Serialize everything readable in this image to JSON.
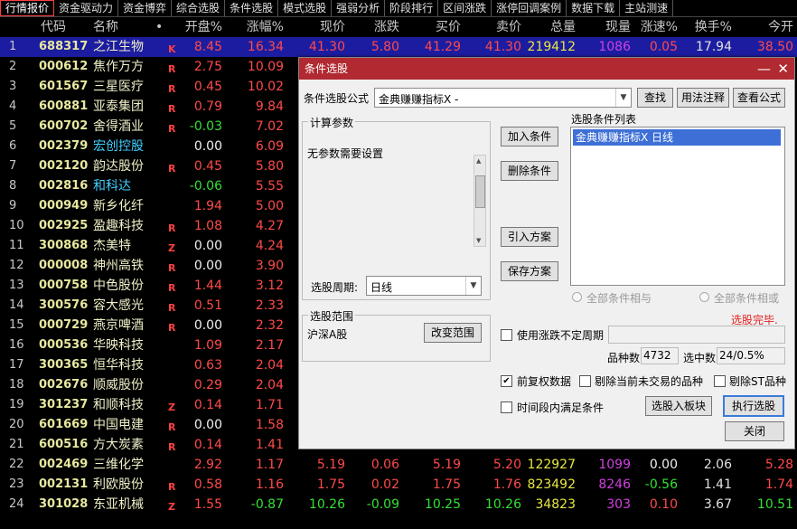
{
  "tabs": [
    "行情报价",
    "资金驱动力",
    "资金博弈",
    "综合选股",
    "条件选股",
    "模式选股",
    "强弱分析",
    "阶段排行",
    "区间涨跌",
    "涨停回调案例",
    "数据下载",
    "主站测速"
  ],
  "columns": {
    "code": "代码",
    "name": "名称",
    "dot": "•",
    "open": "开盘%",
    "chg": "涨幅%",
    "price": "现价",
    "diff": "涨跌",
    "buy": "买价",
    "sell": "卖价",
    "vol": "总量",
    "cur": "现量",
    "spd": "涨速%",
    "turn": "换手%",
    "today": "今开"
  },
  "rows": [
    {
      "idx": "1",
      "code": "688317",
      "name": "之江生物",
      "mark": "K",
      "open": "8.45",
      "chg": "16.34",
      "price": "41.30",
      "diff": "5.80",
      "buy": "41.29",
      "sell": "41.30",
      "vol": "219412",
      "cur": "1086",
      "spd": "0.05",
      "turn": "17.94",
      "today": "38.50",
      "oc": "red",
      "cc": "red",
      "nc": ""
    },
    {
      "idx": "2",
      "code": "000612",
      "name": "焦作万方",
      "mark": "R",
      "open": "2.75",
      "chg": "10.09",
      "oc": "red",
      "cc": "red",
      "nc": ""
    },
    {
      "idx": "3",
      "code": "601567",
      "name": "三星医疗",
      "mark": "R",
      "open": "0.45",
      "chg": "10.02",
      "oc": "red",
      "cc": "red",
      "nc": ""
    },
    {
      "idx": "4",
      "code": "600881",
      "name": "亚泰集团",
      "mark": "R",
      "open": "0.79",
      "chg": "9.84",
      "oc": "red",
      "cc": "red",
      "nc": ""
    },
    {
      "idx": "5",
      "code": "600702",
      "name": "舍得酒业",
      "mark": "R",
      "open": "-0.03",
      "chg": "7.02",
      "oc": "green",
      "cc": "red",
      "nc": ""
    },
    {
      "idx": "6",
      "code": "002379",
      "name": "宏创控股",
      "mark": "",
      "open": "0.00",
      "chg": "6.09",
      "oc": "white",
      "cc": "red",
      "nc": "cyan"
    },
    {
      "idx": "7",
      "code": "002120",
      "name": "韵达股份",
      "mark": "R",
      "open": "0.45",
      "chg": "5.80",
      "oc": "red",
      "cc": "red",
      "nc": ""
    },
    {
      "idx": "8",
      "code": "002816",
      "name": "和科达",
      "mark": "",
      "open": "-0.06",
      "chg": "5.55",
      "oc": "green",
      "cc": "red",
      "nc": "cyan"
    },
    {
      "idx": "9",
      "code": "000949",
      "name": "新乡化纤",
      "mark": "",
      "open": "1.94",
      "chg": "5.00",
      "oc": "red",
      "cc": "red",
      "nc": ""
    },
    {
      "idx": "10",
      "code": "002925",
      "name": "盈趣科技",
      "mark": "R",
      "open": "1.08",
      "chg": "4.27",
      "oc": "red",
      "cc": "red",
      "nc": ""
    },
    {
      "idx": "11",
      "code": "300868",
      "name": "杰美特",
      "mark": "Z",
      "open": "0.00",
      "chg": "4.24",
      "oc": "white",
      "cc": "red",
      "nc": ""
    },
    {
      "idx": "12",
      "code": "000008",
      "name": "神州高铁",
      "mark": "R",
      "open": "0.00",
      "chg": "3.90",
      "oc": "white",
      "cc": "red",
      "nc": ""
    },
    {
      "idx": "13",
      "code": "000758",
      "name": "中色股份",
      "mark": "R",
      "open": "1.44",
      "chg": "3.12",
      "oc": "red",
      "cc": "red",
      "nc": ""
    },
    {
      "idx": "14",
      "code": "300576",
      "name": "容大感光",
      "mark": "R",
      "open": "0.51",
      "chg": "2.33",
      "oc": "red",
      "cc": "red",
      "nc": ""
    },
    {
      "idx": "15",
      "code": "000729",
      "name": "燕京啤酒",
      "mark": "R",
      "open": "0.00",
      "chg": "2.32",
      "oc": "white",
      "cc": "red",
      "nc": ""
    },
    {
      "idx": "16",
      "code": "000536",
      "name": "华映科技",
      "mark": "",
      "open": "1.09",
      "chg": "2.17",
      "oc": "red",
      "cc": "red",
      "nc": ""
    },
    {
      "idx": "17",
      "code": "300365",
      "name": "恒华科技",
      "mark": "",
      "open": "0.63",
      "chg": "2.04",
      "oc": "red",
      "cc": "red",
      "nc": ""
    },
    {
      "idx": "18",
      "code": "002676",
      "name": "顺威股份",
      "mark": "",
      "open": "0.29",
      "chg": "2.04",
      "oc": "red",
      "cc": "red",
      "nc": ""
    },
    {
      "idx": "19",
      "code": "301237",
      "name": "和顺科技",
      "mark": "Z",
      "open": "0.14",
      "chg": "1.71",
      "oc": "red",
      "cc": "red",
      "nc": ""
    },
    {
      "idx": "20",
      "code": "601669",
      "name": "中国电建",
      "mark": "R",
      "open": "0.00",
      "chg": "1.58",
      "oc": "white",
      "cc": "red",
      "nc": ""
    },
    {
      "idx": "21",
      "code": "600516",
      "name": "方大炭素",
      "mark": "R",
      "open": "0.14",
      "chg": "1.41",
      "oc": "red",
      "cc": "red",
      "nc": ""
    },
    {
      "idx": "22",
      "code": "002469",
      "name": "三维化学",
      "mark": "",
      "open": "2.92",
      "chg": "1.17",
      "price": "5.19",
      "diff": "0.06",
      "buy": "5.19",
      "sell": "5.20",
      "vol": "122927",
      "cur": "1099",
      "spd": "0.00",
      "turn": "2.06",
      "today": "5.28",
      "oc": "red",
      "cc": "red",
      "nc": ""
    },
    {
      "idx": "23",
      "code": "002131",
      "name": "利欧股份",
      "mark": "R",
      "open": "0.58",
      "chg": "1.16",
      "price": "1.75",
      "diff": "0.02",
      "buy": "1.75",
      "sell": "1.76",
      "vol": "823492",
      "cur": "8246",
      "spd": "-0.56",
      "turn": "1.41",
      "today": "1.74",
      "oc": "red",
      "cc": "red",
      "nc": ""
    },
    {
      "idx": "24",
      "code": "301028",
      "name": "东亚机械",
      "mark": "Z",
      "open": "1.55",
      "chg": "-0.87",
      "price": "10.26",
      "diff": "-0.09",
      "buy": "10.25",
      "sell": "10.26",
      "vol": "34823",
      "cur": "303",
      "spd": "0.10",
      "turn": "3.67",
      "today": "10.51",
      "oc": "red",
      "cc": "green",
      "nc": ""
    }
  ],
  "dialog": {
    "title": "条件选股",
    "formula_label": "条件选股公式",
    "formula_value": "金典赚赚指标X -",
    "btn_find": "查找",
    "btn_usage": "用法注释",
    "btn_view": "查看公式",
    "calc_group": "计算参数",
    "calc_text": "无参数需要设置",
    "period_label": "选股周期:",
    "period_value": "日线",
    "btn_add": "加入条件",
    "btn_del": "删除条件",
    "btn_import": "引入方案",
    "btn_save": "保存方案",
    "list_label": "选股条件列表",
    "list_item": "金典赚赚指标X  日线",
    "radio_and": "全部条件相与",
    "radio_or": "全部条件相或",
    "status": "选股完毕.",
    "range_group": "选股范围",
    "range_value": "沪深A股",
    "btn_range": "改变范围",
    "use_period": "使用涨跌不定周期",
    "count_label": "品种数",
    "count_value": "4732",
    "hit_label": "选中数",
    "hit_value": "24/0.5%",
    "pre_adj": "前复权数据",
    "excl_untraded": "剔除当前未交易的品种",
    "excl_st": "剔除ST品种",
    "time_satisfy": "时间段内满足条件",
    "btn_to_block": "选股入板块",
    "btn_exec": "执行选股",
    "btn_close": "关闭",
    "win_min": "—",
    "win_close": "✕"
  },
  "colors": {
    "red": "#ff4a4a",
    "green": "#34e034",
    "title_bar": "#b12a31",
    "selected_row": "#1c1ca0"
  }
}
